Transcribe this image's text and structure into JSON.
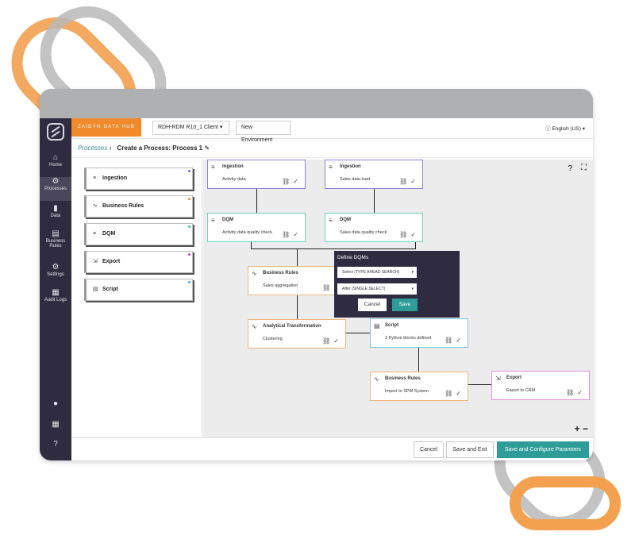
{
  "brand": "ZAIDYN DATA HUB",
  "client_select": "RDH-RDM R10_1 Client",
  "env_button": "New Environment",
  "language": "English (US)",
  "breadcrumb": {
    "parent": "Processes",
    "current": "Create a Process: Process 1"
  },
  "sidebar": {
    "items": [
      {
        "label": "Home",
        "icon": "home-icon"
      },
      {
        "label": "Processes",
        "icon": "gears-icon"
      },
      {
        "label": "Data",
        "icon": "bar-chart-icon"
      },
      {
        "label": "Business Rules",
        "icon": "clipboard-icon"
      },
      {
        "label": "Settings",
        "icon": "gear-icon"
      },
      {
        "label": "Audit Logs",
        "icon": "calendar-icon"
      }
    ]
  },
  "palette": [
    {
      "label": "Ingestion",
      "icon": "database-icon",
      "color": "#7b61ff"
    },
    {
      "label": "Business Rules",
      "icon": "rules-icon",
      "color": "#f08a2c"
    },
    {
      "label": "DQM",
      "icon": "dqm-icon",
      "color": "#33c9a8"
    },
    {
      "label": "Export",
      "icon": "export-icon",
      "color": "#d23ad2"
    },
    {
      "label": "Script",
      "icon": "script-icon",
      "color": "#3fa9f5"
    }
  ],
  "nodes": {
    "ing1": {
      "title": "Ingestion",
      "sub": "Activity data"
    },
    "ing2": {
      "title": "Ingestion",
      "sub": "Sales data load"
    },
    "dqm1": {
      "title": "DQM",
      "sub": "Activity data quality check"
    },
    "dqm2": {
      "title": "DQM",
      "sub": "Sales data quality check"
    },
    "br1": {
      "title": "Business Rules",
      "sub": "Sales aggregation"
    },
    "at": {
      "title": "Analytical Transformation",
      "sub": "Clustering"
    },
    "script": {
      "title": "Script",
      "sub": "2 Python blocks defined"
    },
    "br2": {
      "title": "Business Rules",
      "sub": "Import to SPM System"
    },
    "export": {
      "title": "Export",
      "sub": "Export to CRM"
    }
  },
  "popup": {
    "title": "Define DQMs",
    "select1": "Select (TYPE AHEAD SEARCH)",
    "select2": "After (SINGLE SELECT)",
    "cancel": "Cancel",
    "save": "Save"
  },
  "footer": {
    "cancel": "Cancel",
    "save_exit": "Save and Exit",
    "save_configure": "Save and Configure Paramters"
  },
  "zoom": {
    "plus": "+",
    "minus": "−"
  }
}
